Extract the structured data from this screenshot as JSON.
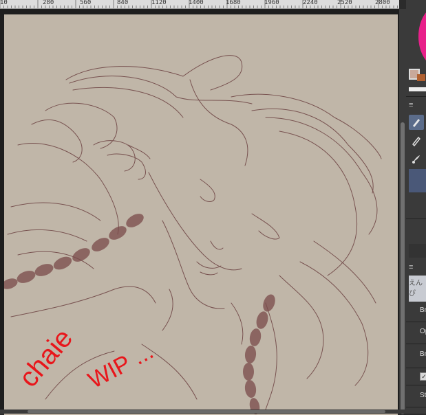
{
  "ruler": {
    "ticks": [
      "10",
      "280",
      "560",
      "840",
      "1120",
      "1400",
      "1680",
      "1960",
      "2240",
      "2520",
      "2800"
    ]
  },
  "canvas": {
    "annotation_name": "chaie",
    "annotation_status": "WIP ...",
    "paper_color": "#c0b6a8",
    "line_color": "#6b4040",
    "annotation_color": "#e8161b"
  },
  "side_panel": {
    "color_wheel_color": "#e8208a",
    "menu_icon": "≡",
    "tools": [
      "pen-tool-icon",
      "pencil-tool-icon",
      "brush-tool-icon"
    ],
    "layer_name": "えんぴ",
    "properties": {
      "brush_size_label": "Br",
      "opacity_label": "Op",
      "brush_density_label": "Br",
      "stabilization_label": "St"
    },
    "checkbox_mark": "✓"
  }
}
